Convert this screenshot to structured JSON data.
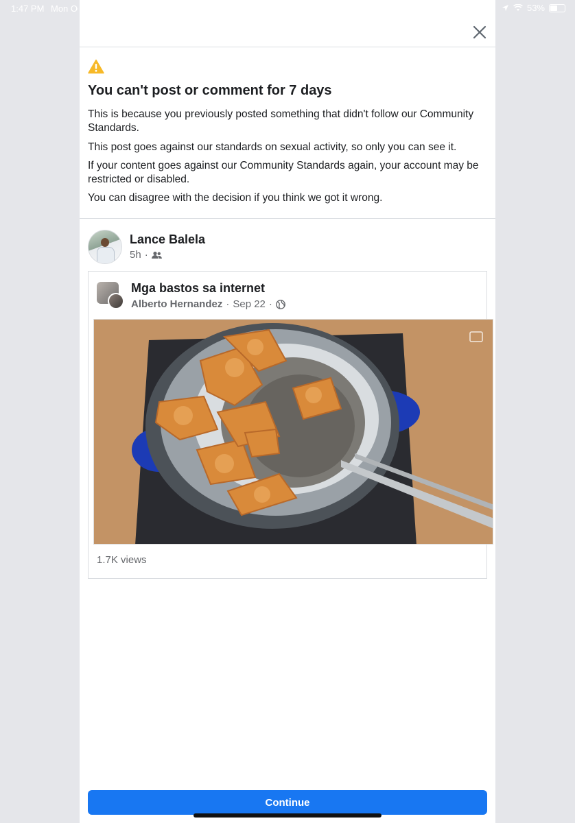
{
  "status_bar": {
    "time": "1:47 PM",
    "date": "Mon Oct",
    "battery_text": "53%",
    "battery_level": 0.53,
    "icons": [
      "location-icon",
      "wifi-icon",
      "battery-icon"
    ]
  },
  "dialog": {
    "close_icon": "close-icon",
    "warning_icon": "warning-icon",
    "title": "You can't post or comment for 7 days",
    "paragraphs": [
      "This is because you previously posted something that didn't follow our Community Standards.",
      "This post goes against our standards on sexual activity, so only you can see it.",
      "If your content goes against our Community Standards again, your account may be restricted or disabled.",
      "You can disagree with the decision if you think we got it wrong."
    ]
  },
  "post": {
    "author": "Lance Balela",
    "time": "5h",
    "separator": "·",
    "audience_icon": "friends-icon",
    "shared": {
      "group_name": "Mga bastos sa internet",
      "author": "Alberto Hernandez",
      "date": "Sep 22",
      "audience_icon": "globe-icon",
      "views": "1.7K views"
    }
  },
  "continue_label": "Continue",
  "colors": {
    "accent": "#1877f2",
    "warning": "#f7b928",
    "secondary_text": "#65676b",
    "divider": "#dadde1"
  }
}
